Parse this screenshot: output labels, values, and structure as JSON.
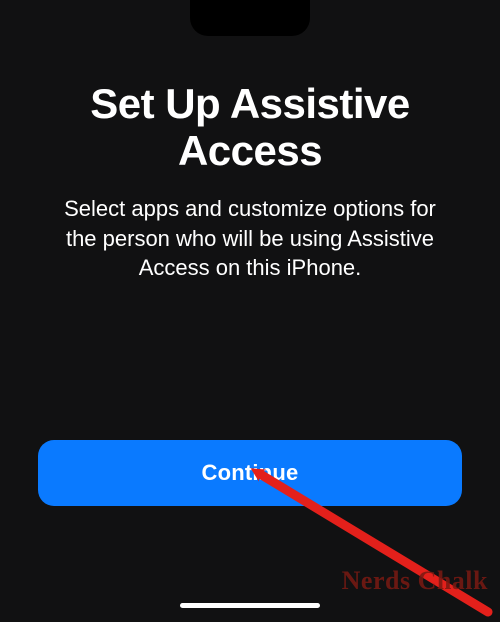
{
  "main": {
    "title": "Set Up Assistive Access",
    "description": "Select apps and customize options for the person who will be using Assistive Access on this iPhone.",
    "continue_label": "Continue"
  },
  "watermark": "Nerds Chalk",
  "colors": {
    "background": "#111112",
    "accent": "#0a7aff",
    "arrow": "#e3201b",
    "watermark": "#7a1a12"
  }
}
